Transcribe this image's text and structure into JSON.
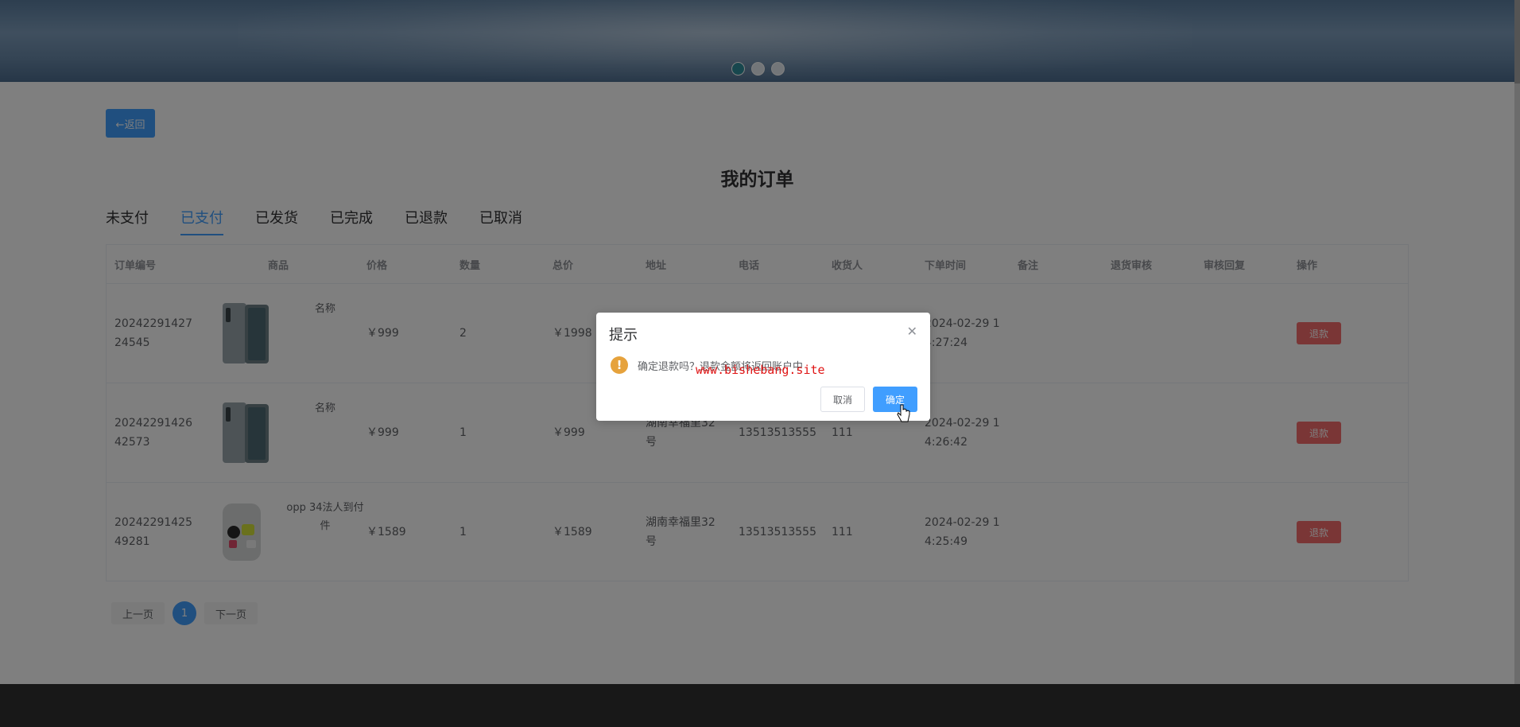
{
  "nav": {
    "back_label": "←返回"
  },
  "page": {
    "title": "我的订单"
  },
  "tabs": [
    {
      "label": "未支付",
      "active": false
    },
    {
      "label": "已支付",
      "active": true
    },
    {
      "label": "已发货",
      "active": false
    },
    {
      "label": "已完成",
      "active": false
    },
    {
      "label": "已退款",
      "active": false
    },
    {
      "label": "已取消",
      "active": false
    }
  ],
  "table": {
    "headers": [
      "订单编号",
      "商品",
      "价格",
      "数量",
      "总价",
      "地址",
      "电话",
      "收货人",
      "下单时间",
      "备注",
      "退货审核",
      "审核回复",
      "操作"
    ],
    "rows": [
      {
        "order_id": "2024229142724545",
        "product": "名称",
        "price": "￥999",
        "qty": "2",
        "total": "￥1998",
        "address": "",
        "phone": "",
        "receiver": "",
        "time": "2024-02-29 14:27:24",
        "action": "退款"
      },
      {
        "order_id": "2024229142642573",
        "product": "名称",
        "price": "￥999",
        "qty": "1",
        "total": "￥999",
        "address": "湖南幸福里32号",
        "phone": "13513513555",
        "receiver": "111",
        "time": "2024-02-29 14:26:42",
        "action": "退款"
      },
      {
        "order_id": "2024229142549281",
        "product": "opp 34法人到付件",
        "price": "￥1589",
        "qty": "1",
        "total": "￥1589",
        "address": "湖南幸福里32号",
        "phone": "13513513555",
        "receiver": "111",
        "time": "2024-02-29 14:25:49",
        "action": "退款"
      }
    ]
  },
  "pager": {
    "prev": "上一页",
    "page": "1",
    "next": "下一页"
  },
  "dialog": {
    "title": "提示",
    "message": "确定退款吗？退款金额将返回账户中",
    "watermark": "www.bishebang.site",
    "cancel": "取消",
    "confirm": "确定"
  },
  "colors": {
    "primary": "#409eff",
    "danger": "#f56c6c",
    "warning": "#e6a23c"
  }
}
